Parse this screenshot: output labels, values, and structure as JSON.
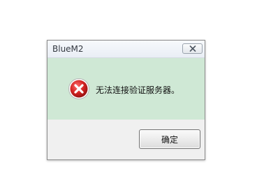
{
  "dialog": {
    "title": "BlueM2",
    "message": "无法连接验证服务器。",
    "ok_label": "确定",
    "close_icon": "close-icon",
    "status_icon": "error-icon"
  },
  "colors": {
    "content_background": "#cfe8d5",
    "error_red": "#d42323"
  }
}
